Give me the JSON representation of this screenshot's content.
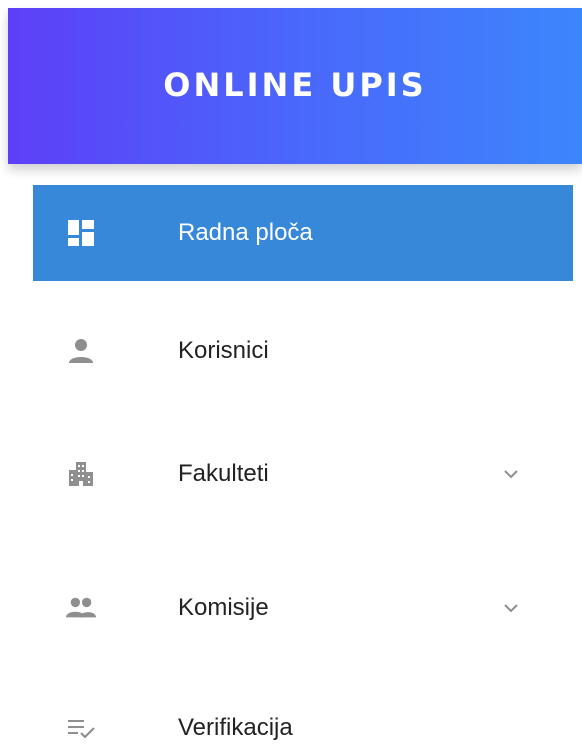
{
  "header": {
    "title": "ONLINE UPIS",
    "gradient_start": "#5d3ff8",
    "gradient_end": "#3c86fc"
  },
  "colors": {
    "active_bg": "#3788d8",
    "icon_gray": "#8f8f8f",
    "text": "#222222"
  },
  "nav": {
    "items": [
      {
        "label": "Radna ploča",
        "icon": "dashboard-icon",
        "active": true,
        "expandable": false
      },
      {
        "label": "Korisnici",
        "icon": "person-icon",
        "active": false,
        "expandable": false
      },
      {
        "label": "Fakulteti",
        "icon": "building-icon",
        "active": false,
        "expandable": true
      },
      {
        "label": "Komisije",
        "icon": "people-icon",
        "active": false,
        "expandable": true
      },
      {
        "label": "Verifikacija",
        "icon": "playlist-check-icon",
        "active": false,
        "expandable": false
      }
    ]
  }
}
